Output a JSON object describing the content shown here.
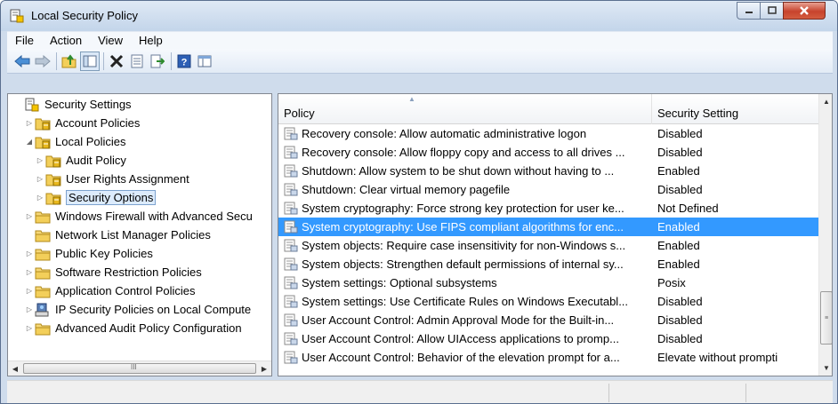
{
  "window": {
    "title": "Local Security Policy",
    "icon": "security-policy-icon"
  },
  "menu": [
    "File",
    "Action",
    "View",
    "Help"
  ],
  "toolbar": {
    "buttons": [
      "back-arrow-icon",
      "forward-arrow-icon",
      "up-folder-icon",
      "show-hide-tree-icon",
      "delete-icon",
      "properties-icon",
      "export-list-icon",
      "help-icon",
      "console-icon"
    ]
  },
  "tree": {
    "items": [
      {
        "label": "Security Settings",
        "icon": "security-settings-icon",
        "arrow": "",
        "indent": 0
      },
      {
        "label": "Account Policies",
        "icon": "policy-folder-icon",
        "arrow": "▷",
        "indent": 1
      },
      {
        "label": "Local Policies",
        "icon": "policy-folder-icon",
        "arrow": "◢",
        "indent": 1
      },
      {
        "label": "Audit Policy",
        "icon": "policy-folder-icon",
        "arrow": "▷",
        "indent": 2
      },
      {
        "label": "User Rights Assignment",
        "icon": "policy-folder-icon",
        "arrow": "▷",
        "indent": 2
      },
      {
        "label": "Security Options",
        "icon": "policy-folder-icon",
        "arrow": "▷",
        "indent": 2,
        "selected": true
      },
      {
        "label": "Windows Firewall with Advanced Secu",
        "icon": "folder-icon",
        "arrow": "▷",
        "indent": 1
      },
      {
        "label": "Network List Manager Policies",
        "icon": "folder-icon",
        "arrow": "",
        "indent": 1
      },
      {
        "label": "Public Key Policies",
        "icon": "folder-icon",
        "arrow": "▷",
        "indent": 1
      },
      {
        "label": "Software Restriction Policies",
        "icon": "folder-icon",
        "arrow": "▷",
        "indent": 1
      },
      {
        "label": "Application Control Policies",
        "icon": "folder-icon",
        "arrow": "▷",
        "indent": 1
      },
      {
        "label": "IP Security Policies on Local Compute",
        "icon": "ip-security-icon",
        "arrow": "▷",
        "indent": 1
      },
      {
        "label": "Advanced Audit Policy Configuration",
        "icon": "folder-icon",
        "arrow": "▷",
        "indent": 1
      }
    ],
    "hscroll_thumb_glyph": "III"
  },
  "list": {
    "columns": [
      "Policy",
      "Security Setting"
    ],
    "rows": [
      {
        "policy": "Recovery console: Allow automatic administrative logon",
        "setting": "Disabled"
      },
      {
        "policy": "Recovery console: Allow floppy copy and access to all drives ...",
        "setting": "Disabled"
      },
      {
        "policy": "Shutdown: Allow system to be shut down without having to ...",
        "setting": "Enabled"
      },
      {
        "policy": "Shutdown: Clear virtual memory pagefile",
        "setting": "Disabled"
      },
      {
        "policy": "System cryptography: Force strong key protection for user ke...",
        "setting": "Not Defined"
      },
      {
        "policy": "System cryptography: Use FIPS compliant algorithms for enc...",
        "setting": "Enabled",
        "selected": true
      },
      {
        "policy": "System objects: Require case insensitivity for non-Windows s...",
        "setting": "Enabled"
      },
      {
        "policy": "System objects: Strengthen default permissions of internal sy...",
        "setting": "Enabled"
      },
      {
        "policy": "System settings: Optional subsystems",
        "setting": "Posix"
      },
      {
        "policy": "System settings: Use Certificate Rules on Windows Executabl...",
        "setting": "Disabled"
      },
      {
        "policy": "User Account Control: Admin Approval Mode for the Built-in...",
        "setting": "Disabled"
      },
      {
        "policy": "User Account Control: Allow UIAccess applications to promp...",
        "setting": "Disabled"
      },
      {
        "policy": "User Account Control: Behavior of the elevation prompt for a...",
        "setting": "Elevate without prompti"
      }
    ],
    "vscroll_thumb_glyph": "≡"
  },
  "colors": {
    "selection": "#3399ff",
    "tree_selection": "#dcebfc",
    "window_frame": "#cfdcec"
  }
}
